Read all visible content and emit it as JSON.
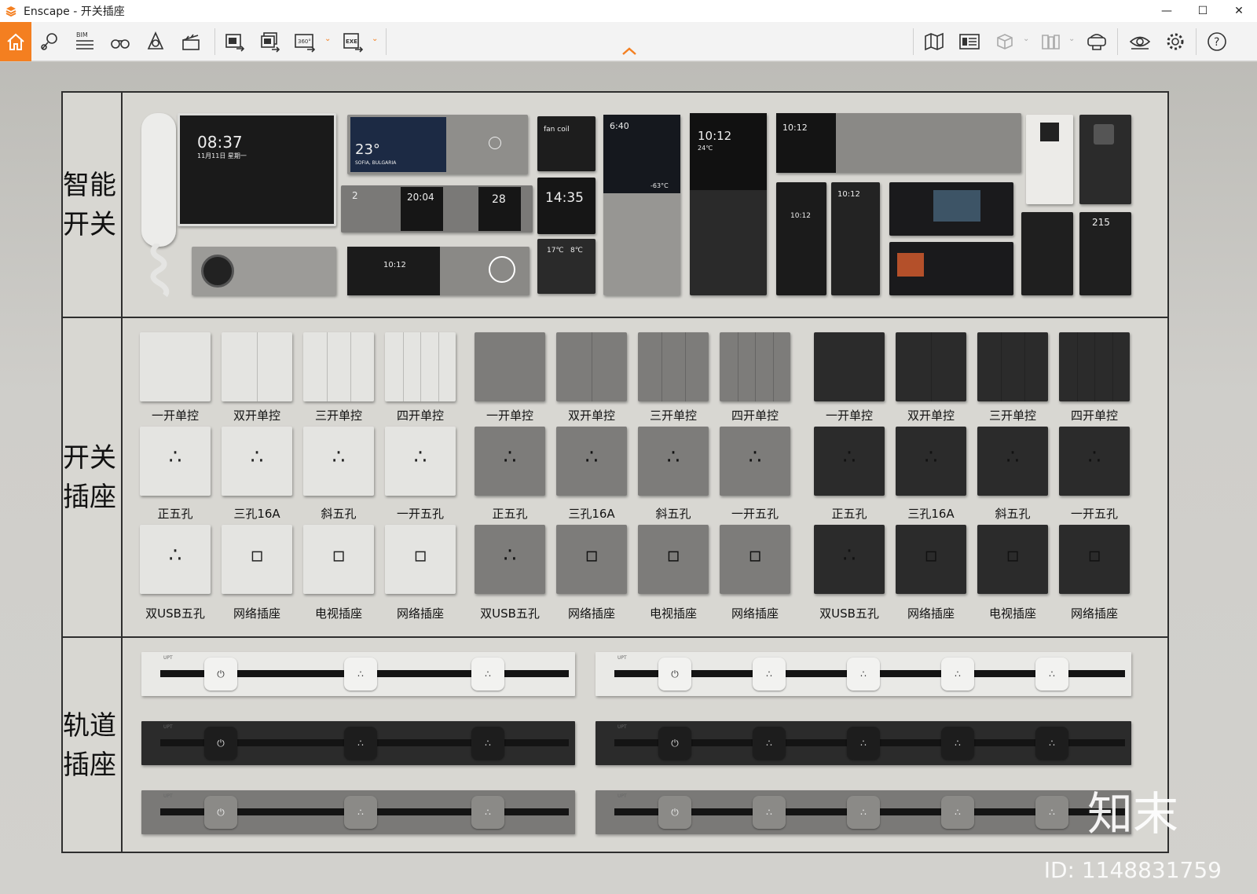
{
  "window": {
    "title": "Enscape - 开关插座",
    "controls": [
      "—",
      "☐",
      "✕"
    ]
  },
  "toolbar": {
    "left_tools": [
      "home-icon",
      "location-pin-icon",
      "bim-icon",
      "binoculars-icon",
      "audio-speaker-icon",
      "video-clapper-icon",
      "screenshot-export-icon",
      "batch-export-icon",
      "panorama-360-icon",
      "exe-export-icon"
    ],
    "bim_label": "BIM",
    "p360_label": "360°",
    "exe_label": "EXE",
    "right_tools": [
      "map-icon",
      "asset-library-icon",
      "cube-icon",
      "book-icon",
      "headset-icon",
      "eye-icon",
      "gear-icon",
      "help-icon"
    ],
    "collapse": "^"
  },
  "sections": {
    "smart": "智能开关",
    "switch": "开关插座",
    "track": "轨道插座"
  },
  "smart_screens": {
    "intercom_time": "08:37",
    "intercom_date": "11月11日 星期一",
    "weather_temp": "23°",
    "weather_city": "SOFIA, BULGARIA",
    "fan_label": "fan coil",
    "night_time": "6:40",
    "night_temp": "-63°C",
    "clock_a": "10:12",
    "clock_b": "10:12",
    "clock_c": "10:12",
    "clock_d": "10:12",
    "clock_e": "10:12",
    "therm": "20:04",
    "therm2": "28",
    "big_clock": "14:35",
    "temp_small": "17℃",
    "temp_small2": "8℃",
    "panel_num": "215",
    "small_2": "2",
    "temp_24": "24℃"
  },
  "switch_rows": {
    "row1": [
      "一开单控",
      "双开单控",
      "三开单控",
      "四开单控",
      "一开单控",
      "双开单控",
      "三开单控",
      "四开单控",
      "一开单控",
      "双开单控",
      "三开单控",
      "四开单控"
    ],
    "row2": [
      "正五孔",
      "三孔16A",
      "斜五孔",
      "一开五孔",
      "正五孔",
      "三孔16A",
      "斜五孔",
      "一开五孔",
      "正五孔",
      "三孔16A",
      "斜五孔",
      "一开五孔"
    ],
    "row3": [
      "双USB五孔",
      "网络插座",
      "电视插座",
      "网络插座",
      "双USB五孔",
      "网络插座",
      "电视插座",
      "网络插座",
      "双USB五孔",
      "网络插座",
      "电视插座",
      "网络插座"
    ]
  },
  "track": {
    "tag": "UPT",
    "power_glyph": "⏻",
    "outlet_glyph": "∴"
  },
  "colors": {
    "accent": "#f47f20",
    "white_panel": "#e4e4e1",
    "grey_panel": "#7d7c7a",
    "black_panel": "#2b2b2b"
  },
  "watermark": {
    "brand": "知末",
    "id": "ID: 1148831759"
  }
}
